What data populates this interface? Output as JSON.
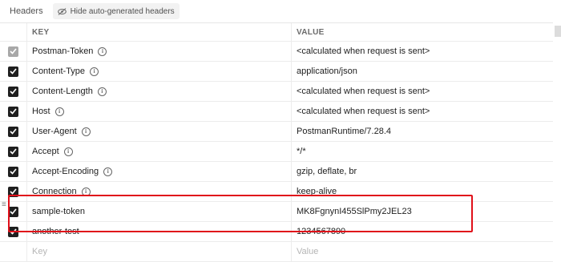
{
  "topbar": {
    "title": "Headers",
    "hide_button_label": "Hide auto-generated headers",
    "hide_button_icon": "eye-slash-icon"
  },
  "table": {
    "columns": [
      "KEY",
      "VALUE"
    ],
    "rows": [
      {
        "checked": true,
        "disabled": true,
        "key": "Postman-Token",
        "info": true,
        "value": "<calculated when request is sent>"
      },
      {
        "checked": true,
        "key": "Content-Type",
        "info": true,
        "value": "application/json"
      },
      {
        "checked": true,
        "key": "Content-Length",
        "info": true,
        "value": "<calculated when request is sent>"
      },
      {
        "checked": true,
        "key": "Host",
        "info": true,
        "value": "<calculated when request is sent>"
      },
      {
        "checked": true,
        "key": "User-Agent",
        "info": true,
        "value": "PostmanRuntime/7.28.4"
      },
      {
        "checked": true,
        "key": "Accept",
        "info": true,
        "value": "*/*"
      },
      {
        "checked": true,
        "key": "Accept-Encoding",
        "info": true,
        "value": "gzip, deflate, br"
      },
      {
        "checked": true,
        "key": "Connection",
        "info": true,
        "value": "keep-alive"
      },
      {
        "checked": true,
        "key": "sample-token",
        "info": false,
        "value": "MK8FgnynI455SlPmy2JEL23"
      },
      {
        "checked": true,
        "key": "another-test",
        "info": false,
        "value": "1234567890"
      }
    ],
    "new_row": {
      "key_placeholder": "Key",
      "value_placeholder": "Value"
    }
  },
  "colors": {
    "accent_underline": "#f26b3a",
    "highlight_border": "#e0101a"
  }
}
